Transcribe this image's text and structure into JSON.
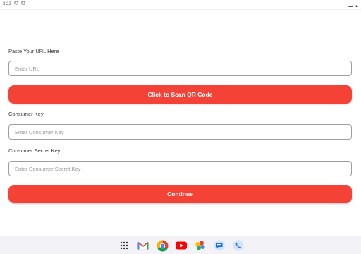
{
  "status_bar": {
    "time": "3:22",
    "wifi_icon": "wifi-icon",
    "battery_icon": "battery-icon"
  },
  "form": {
    "url_label": "Paste Your URL Here",
    "url_placeholder": "Enter URL",
    "url_value": "",
    "scan_button_label": "Click to Scan QR Code",
    "consumer_key_label": "Consumer Key",
    "consumer_key_placeholder": "Enter Consumer Key",
    "consumer_key_value": "",
    "consumer_secret_label": "Consumer Secret Key",
    "consumer_secret_placeholder": "Enter Consumer Secret Key",
    "consumer_secret_value": "",
    "continue_button_label": "Continue"
  },
  "colors": {
    "primary_button": "#f44336",
    "field_border": "#9e9e9e",
    "nav_bar": "#f2f2f7"
  },
  "dock": {
    "apps": [
      "app-drawer-icon",
      "gmail-icon",
      "chrome-icon",
      "youtube-icon",
      "photos-icon",
      "messages-icon",
      "phone-icon"
    ]
  }
}
